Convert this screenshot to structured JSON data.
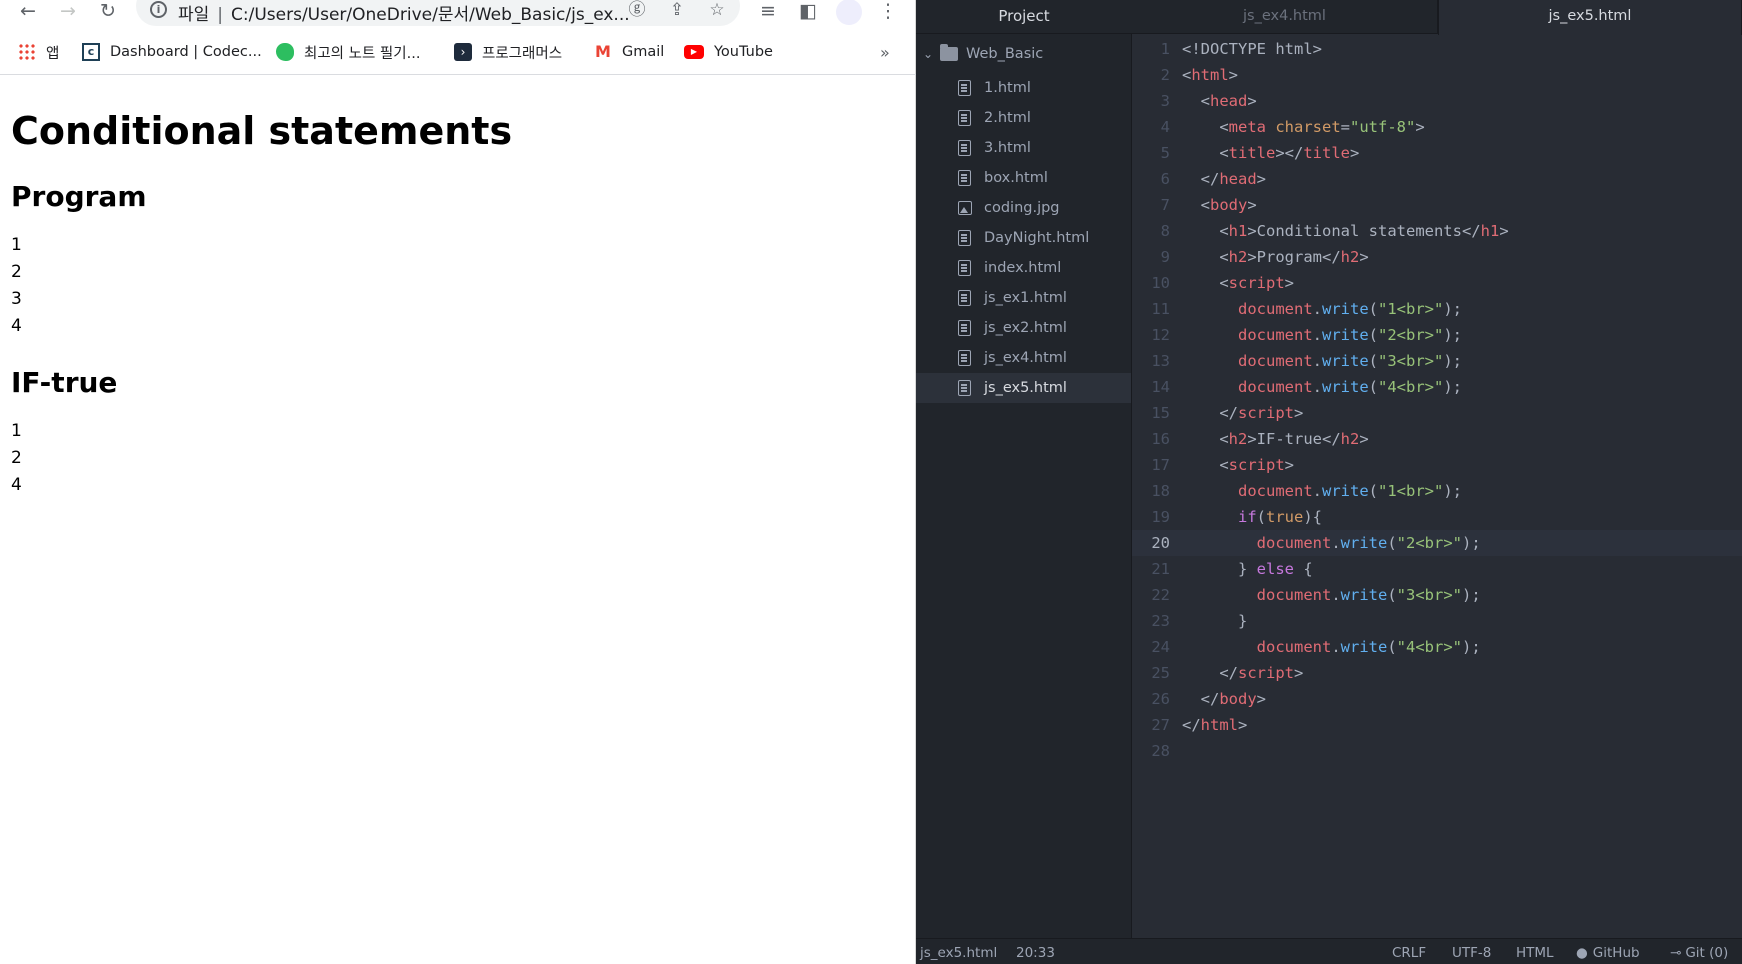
{
  "browser": {
    "address": {
      "protocol_label": "파일",
      "url": "C:/Users/User/OneDrive/문서/Web_Basic/js_ex..."
    },
    "bookmarks": [
      {
        "label": "앱"
      },
      {
        "label": "Dashboard | Codec..."
      },
      {
        "label": "최고의 노트 필기..."
      },
      {
        "label": "프로그래머스"
      },
      {
        "label": "Gmail"
      },
      {
        "label": "YouTube"
      }
    ],
    "overflow_label": "»",
    "page": {
      "h1": "Conditional statements",
      "section1_heading": "Program",
      "section1_lines": [
        "1",
        "2",
        "3",
        "4"
      ],
      "section2_heading": "IF-true",
      "section2_lines": [
        "1",
        "2",
        "4"
      ]
    }
  },
  "editor": {
    "tree_header": "Project",
    "root_folder": "Web_Basic",
    "files": [
      {
        "name": "1.html",
        "kind": "file"
      },
      {
        "name": "2.html",
        "kind": "file"
      },
      {
        "name": "3.html",
        "kind": "file"
      },
      {
        "name": "box.html",
        "kind": "file"
      },
      {
        "name": "coding.jpg",
        "kind": "image"
      },
      {
        "name": "DayNight.html",
        "kind": "file"
      },
      {
        "name": "index.html",
        "kind": "file"
      },
      {
        "name": "js_ex1.html",
        "kind": "file"
      },
      {
        "name": "js_ex2.html",
        "kind": "file"
      },
      {
        "name": "js_ex4.html",
        "kind": "file"
      },
      {
        "name": "js_ex5.html",
        "kind": "file",
        "active": true
      }
    ],
    "tabs": [
      {
        "label": "js_ex4.html",
        "active": false
      },
      {
        "label": "js_ex5.html",
        "active": true
      }
    ],
    "current_line": 20,
    "status": {
      "file": "js_ex5.html",
      "cursor": "20:33",
      "line_ending": "CRLF",
      "encoding": "UTF-8",
      "grammar": "HTML",
      "github": "GitHub",
      "git": "Git (0)"
    }
  }
}
